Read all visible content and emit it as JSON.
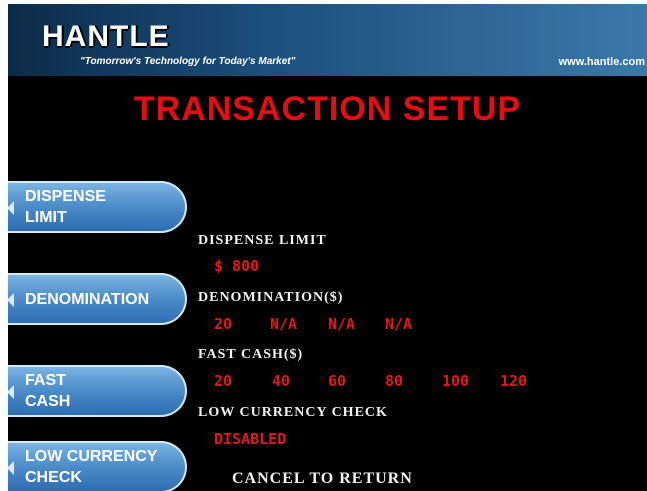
{
  "header": {
    "logo": "HANTLE",
    "tagline": "\"Tomorrow's Technology for Today's Market\"",
    "website": "www.hantle.com"
  },
  "title": "TRANSACTION SETUP",
  "side_buttons": [
    {
      "label_lines": [
        "DISPENSE",
        "LIMIT"
      ]
    },
    {
      "label_lines": [
        "DENOMINATION"
      ]
    },
    {
      "label_lines": [
        "FAST",
        "CASH"
      ]
    },
    {
      "label_lines": [
        "LOW CURRENCY",
        "CHECK"
      ]
    }
  ],
  "settings": {
    "dispense_limit": {
      "label": "DISPENSE LIMIT",
      "value": "$ 800"
    },
    "denomination": {
      "label": "DENOMINATION($)",
      "values": [
        "20",
        "N/A",
        "N/A",
        "N/A"
      ]
    },
    "fast_cash": {
      "label": "FAST CASH($)",
      "values": [
        "20",
        "40",
        "60",
        "80",
        "100",
        "120"
      ]
    },
    "low_currency_check": {
      "label": "LOW CURRENCY CHECK",
      "value": "DISABLED"
    }
  },
  "footer": "CANCEL TO RETURN",
  "colors": {
    "accent_red": "#e60d12",
    "button_blue": "#4f8fca",
    "background": "#000000"
  }
}
